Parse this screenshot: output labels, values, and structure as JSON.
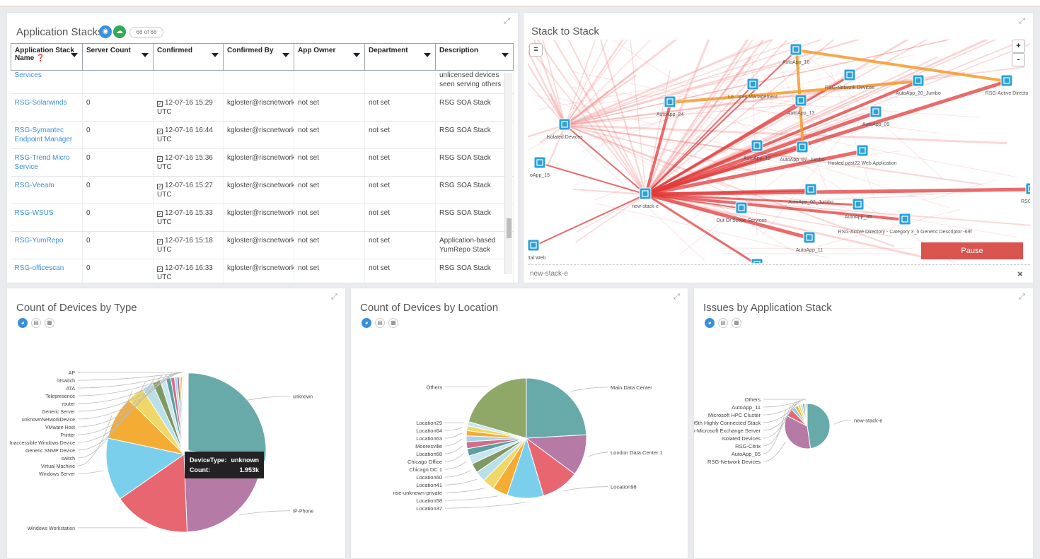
{
  "app_stacks": {
    "title": "Application Stacks",
    "count": "68 of 68",
    "columns": [
      "Application Stack Name",
      "Server Count",
      "Confirmed",
      "Confirmed By",
      "App Owner",
      "Department",
      "Description"
    ],
    "partial_row": {
      "name": "Services",
      "description": "seen serving others",
      "description_top": "unlicensed devices"
    },
    "rows": [
      {
        "name": "RSG-Solarwinds",
        "server_count": "0",
        "confirmed": "12-07-16 15:29 UTC",
        "confirmed_by": "kgloster@riscnetwork",
        "owner": "not set",
        "department": "not set",
        "description": "RSG SOA Stack"
      },
      {
        "name": "RSG-Symantec Endpoint Manager",
        "server_count": "0",
        "confirmed": "12-07-16 16:44 UTC",
        "confirmed_by": "kgloster@riscnetwork",
        "owner": "not set",
        "department": "not set",
        "description": "RSG SOA Stack"
      },
      {
        "name": "RSG-Trend Micro Service",
        "server_count": "0",
        "confirmed": "12-07-16 15:36 UTC",
        "confirmed_by": "kgloster@riscnetwork",
        "owner": "not set",
        "department": "not set",
        "description": "RSG SOA Stack"
      },
      {
        "name": "RSG-Veeam",
        "server_count": "0",
        "confirmed": "12-07-16 15:27 UTC",
        "confirmed_by": "kgloster@riscnetwork",
        "owner": "not set",
        "department": "not set",
        "description": "RSG SOA Stack"
      },
      {
        "name": "RSG-WSUS",
        "server_count": "0",
        "confirmed": "12-07-16 15:33 UTC",
        "confirmed_by": "kgloster@riscnetwork",
        "owner": "not set",
        "department": "not set",
        "description": "RSG SOA Stack"
      },
      {
        "name": "RSG-YumRepo",
        "server_count": "0",
        "confirmed": "12-07-16 15:18 UTC",
        "confirmed_by": "kgloster@riscnetwork",
        "owner": "not set",
        "department": "not set",
        "description": "Application-based YumRepo Stack"
      },
      {
        "name": "RSG-officescan",
        "server_count": "0",
        "confirmed": "12-07-16 16:33 UTC",
        "confirmed_by": "kgloster@riscnetwork",
        "owner": "not set",
        "department": "not set",
        "description": "RSG SOA Stack"
      }
    ]
  },
  "stack_to_stack": {
    "title": "Stack to Stack",
    "menu_icon": "hamburger-icon",
    "zoom_in": "+",
    "zoom_out": "-",
    "pause_label": "Pause",
    "selected": "new-stack-e",
    "close": "×",
    "nodes": [
      "AutoApp_16",
      "RSG-Network Devices",
      "AutoApp_20_Jumbo",
      "RSG-Active Directo",
      "Lo…ices Management",
      "AutoApp_13",
      "AutoApp_24",
      "AutoApp_09",
      "Isolated Devices",
      "AutoApp_12",
      "AutoApp_07_Jumbo",
      "Hosted past22 Web Application",
      "oApp_15",
      "new-stack-e",
      "AutoApp_02_Jumbo",
      "RSG-Citri",
      "Out Of Scope Services",
      "AutoApp_05",
      "RSG-Active Directory - Category 3_5 Generic Descriptor -69f",
      "AutoApp_11",
      "Portal Web",
      "RSG-Microsoft Exchange Server"
    ]
  },
  "charts": {
    "icons": [
      "pie-icon",
      "bar-icon",
      "table-icon"
    ],
    "tooltip": {
      "type_label": "DeviceType:",
      "type_value": "unknown",
      "count_label": "Count:",
      "count_value": "1.953k"
    }
  },
  "chart_data": [
    {
      "type": "pie",
      "title": "Count of Devices by Type",
      "slices": [
        {
          "label": "unknown",
          "value": 1953,
          "color": "#67aaa9"
        },
        {
          "label": "IP-Phone",
          "value": 1600,
          "color": "#b57ba6"
        },
        {
          "label": "Windows Workstation",
          "value": 1150,
          "color": "#e86670"
        },
        {
          "label": "Windows Server",
          "value": 940,
          "color": "#7ad0ec"
        },
        {
          "label": "Virtual Machine",
          "value": 650,
          "color": "#f5ac35"
        },
        {
          "label": "switch",
          "value": 260,
          "color": "#efd867"
        },
        {
          "label": "Generic SNMP Device",
          "value": 170,
          "color": "#b9e0e9"
        },
        {
          "label": "Inaccessible Windows Device",
          "value": 120,
          "color": "#7f9962"
        },
        {
          "label": "Printer",
          "value": 90,
          "color": "#c9e6f0"
        },
        {
          "label": "VMware Host",
          "value": 70,
          "color": "#5aa0a0"
        },
        {
          "label": "unknownNetworkDevice",
          "value": 55,
          "color": "#d56d8a"
        },
        {
          "label": "Generic Server",
          "value": 40,
          "color": "#a6d4e6"
        },
        {
          "label": "router",
          "value": 30,
          "color": "#8a6f9e"
        },
        {
          "label": "Telepresence",
          "value": 25,
          "color": "#f0b04a"
        },
        {
          "label": "ATA",
          "value": 20,
          "color": "#88c1d6"
        },
        {
          "label": "l3switch",
          "value": 15,
          "color": "#e5d36a"
        },
        {
          "label": "AP",
          "value": 12,
          "color": "#f08060"
        }
      ]
    },
    {
      "type": "pie",
      "title": "Count of Devices by Location",
      "slices": [
        {
          "label": "Main Data Center",
          "value": 1700,
          "color": "#67aaa9"
        },
        {
          "label": "London Data Center 1",
          "value": 780,
          "color": "#b57ba6"
        },
        {
          "label": "Location98",
          "value": 720,
          "color": "#e86670"
        },
        {
          "label": "Location37",
          "value": 690,
          "color": "#7ad0ec"
        },
        {
          "label": "Location58",
          "value": 290,
          "color": "#f5ac35"
        },
        {
          "label": "rise-unknown-private",
          "value": 230,
          "color": "#efd867"
        },
        {
          "label": "Location41",
          "value": 200,
          "color": "#b9e0e9"
        },
        {
          "label": "Location60",
          "value": 180,
          "color": "#7f9962"
        },
        {
          "label": "Chicago DC 1",
          "value": 160,
          "color": "#c9e6f0"
        },
        {
          "label": "Chicago Office",
          "value": 140,
          "color": "#5aa0a0"
        },
        {
          "label": "Location68",
          "value": 130,
          "color": "#d56d8a"
        },
        {
          "label": "Mooresville",
          "value": 110,
          "color": "#a6d4e6"
        },
        {
          "label": "Location63",
          "value": 100,
          "color": "#f5ac35"
        },
        {
          "label": "Location64",
          "value": 90,
          "color": "#efd867"
        },
        {
          "label": "Location29",
          "value": 80,
          "color": "#c9e6f0"
        },
        {
          "label": "Others",
          "value": 1450,
          "color": "#8fa868"
        }
      ]
    },
    {
      "type": "pie",
      "title": "Issues by Application Stack",
      "slices": [
        {
          "label": "new-stack-e",
          "value": 520,
          "color": "#67aaa9"
        },
        {
          "label": "RSG-Network Devices",
          "value": 380,
          "color": "#b57ba6"
        },
        {
          "label": "AutoApp_05",
          "value": 60,
          "color": "#e86670"
        },
        {
          "label": "RSG-Citrix",
          "value": 30,
          "color": "#7ad0ec"
        },
        {
          "label": "Isolated Devices",
          "value": 25,
          "color": "#f5ac35"
        },
        {
          "label": "RSG-Microsoft Exchange Server",
          "value": 20,
          "color": "#efd867"
        },
        {
          "label": "RSG-95th Highly Connected Stack",
          "value": 18,
          "color": "#b9e0e9"
        },
        {
          "label": "Microsoft HPC Cluster",
          "value": 15,
          "color": "#7f9962"
        },
        {
          "label": "AutoApp_11",
          "value": 12,
          "color": "#c9e6f0"
        },
        {
          "label": "Others",
          "value": 10,
          "color": "#5aa0a0"
        }
      ]
    }
  ]
}
